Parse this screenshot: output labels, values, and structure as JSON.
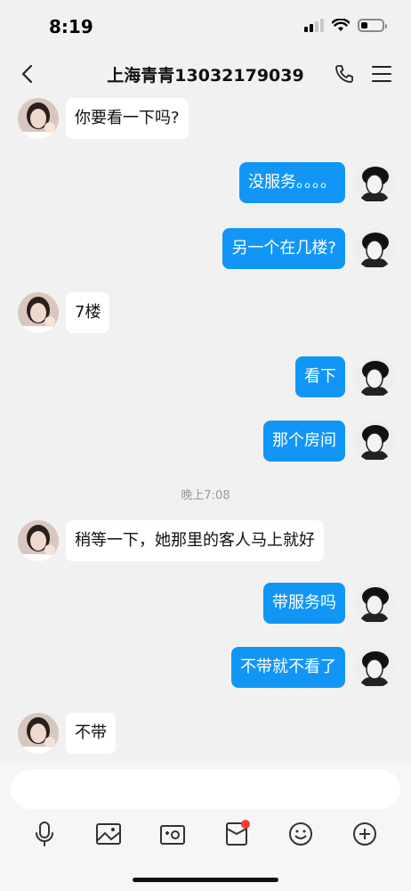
{
  "status_bar": {
    "time": "8:19",
    "battery_level": 0.3,
    "signal_bars": 2
  },
  "header": {
    "title": "上海青青13032179039",
    "back_icon": "chevron-left-icon",
    "call_icon": "phone-icon",
    "menu_icon": "menu-icon"
  },
  "messages": [
    {
      "side": "left",
      "text": "你要看一下吗?"
    },
    {
      "side": "right",
      "text": "没服务。。。。"
    },
    {
      "side": "right",
      "text": "另一个在几楼?"
    },
    {
      "side": "left",
      "text": "7楼"
    },
    {
      "side": "right",
      "text": "看下"
    },
    {
      "side": "right",
      "text": "那个房间"
    },
    {
      "side": "right",
      "text": "带服务吗"
    },
    {
      "side": "right",
      "text": "不带就不看了"
    },
    {
      "side": "left",
      "text": "不带"
    }
  ],
  "timestamp": "晚上7:08",
  "late_message": {
    "side": "left",
    "text": "稍等一下，她那里的客人马上就好"
  },
  "composer": {
    "input_value": "",
    "tools": [
      "microphone-icon",
      "image-icon",
      "camera-icon",
      "red-packet-icon",
      "emoji-icon",
      "plus-icon"
    ]
  },
  "colors": {
    "bubble_self": "#1296f5",
    "bubble_other": "#ffffff",
    "background": "#f1f1f1",
    "badge": "#f53b3b"
  }
}
